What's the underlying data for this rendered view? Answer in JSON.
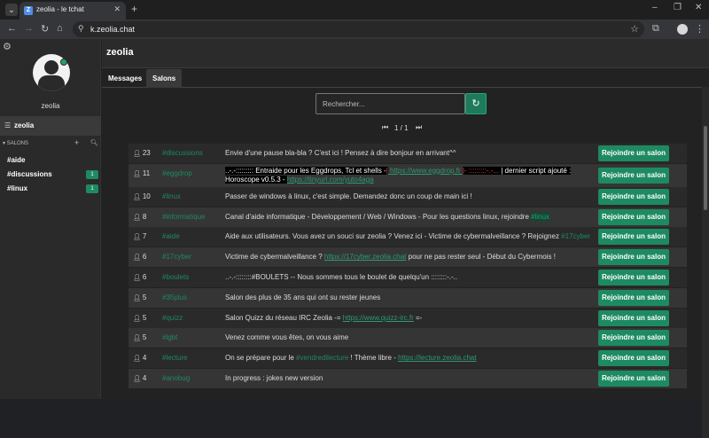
{
  "browser": {
    "tab_title": "zeolia - le tchat",
    "favicon_letter": "Z",
    "url": "k.zeolia.chat"
  },
  "sidebar": {
    "username": "zeolia",
    "server": "zeolia",
    "salons_label": "SALONS",
    "channels": [
      {
        "label": "#aide",
        "badge": ""
      },
      {
        "label": "#discussions",
        "badge": "1"
      },
      {
        "label": "#linux",
        "badge": "1"
      }
    ]
  },
  "main": {
    "title": "zeolia",
    "tabs": [
      "Messages",
      "Salons"
    ],
    "search_placeholder": "Rechercher...",
    "pager": "1 / 1",
    "join_label": "Rejoindre un salon"
  },
  "rows": [
    {
      "users": "23",
      "channel": "#discussions",
      "topic": "Envie d'une pause bla-bla ? C'est ici ! Pensez à dire bonjour en arrivant^^"
    },
    {
      "users": "11",
      "channel": "#eggdrop",
      "topic_parts": [
        {
          "t": "..-.-::::::::: Entraide pour les Eggdrops, Tcl et shells -",
          "c": "hl"
        },
        {
          "t": "|",
          "c": "red"
        },
        {
          "t": " https://www.eggdrop.fr ",
          "c": "lnk"
        },
        {
          "t": "|- :::::::::-.-...",
          "c": "red"
        },
        {
          "t": " | dernier script ajouté : Horoscope v0.5.3 - ",
          "c": "hl"
        },
        {
          "t": "https://tinyurl.com/yuto4aga",
          "c": "lnk"
        }
      ]
    },
    {
      "users": "10",
      "channel": "#linux",
      "topic": "Passer de windows à linux, c'est simple. Demandez donc un coup de main ici !"
    },
    {
      "users": "8",
      "channel": "#informatique",
      "topic_parts": [
        {
          "t": "Canal d'aide informatique - Développement / Web / Windows - Pour les questions linux, rejoindre ",
          "c": ""
        },
        {
          "t": "#linux",
          "c": "grnbg"
        }
      ]
    },
    {
      "users": "7",
      "channel": "#aide",
      "topic_parts": [
        {
          "t": "Aide aux utilisateurs. Vous avez un souci sur zeolia ? Venez ici - Victime de cybermalveillance ? Rejoignez ",
          "c": ""
        },
        {
          "t": "#17cyber",
          "c": "grn"
        }
      ]
    },
    {
      "users": "6",
      "channel": "#17cyber",
      "topic_parts": [
        {
          "t": "Victime de cybermalveillance ? ",
          "c": ""
        },
        {
          "t": "https://17cyber.zeolia.chat",
          "c": "lnk"
        },
        {
          "t": " pour ne pas rester seul - Début du Cybermois !",
          "c": ""
        }
      ]
    },
    {
      "users": "6",
      "channel": "#boulets",
      "topic": "..-.-::::::::#BOULETS -- Nous sommes tous le boulet de quelqu'un ::::::::-.-.."
    },
    {
      "users": "5",
      "channel": "#35plus",
      "topic": "Salon des plus de 35 ans qui ont su rester jeunes"
    },
    {
      "users": "5",
      "channel": "#quizz",
      "topic_parts": [
        {
          "t": "Salon Quizz du réseau IRC Zeolia -= ",
          "c": ""
        },
        {
          "t": "https://www.quizz-irc.fr",
          "c": "lnk"
        },
        {
          "t": " =-",
          "c": ""
        }
      ]
    },
    {
      "users": "5",
      "channel": "#lgbt",
      "topic": "Venez comme vous êtes, on vous aime"
    },
    {
      "users": "4",
      "channel": "#lecture",
      "topic_parts": [
        {
          "t": "On se prépare pour le ",
          "c": ""
        },
        {
          "t": "#vendredilecture",
          "c": "grn"
        },
        {
          "t": " ! Thème libre - ",
          "c": ""
        },
        {
          "t": "https://lecture.zeolia.chat",
          "c": "lnk"
        }
      ]
    },
    {
      "users": "4",
      "channel": "#anobug",
      "topic": "In progress : jokes new version"
    }
  ],
  "colors": {
    "accent": "#1e8a62",
    "link": "#2e9a72",
    "background": "#222222"
  }
}
